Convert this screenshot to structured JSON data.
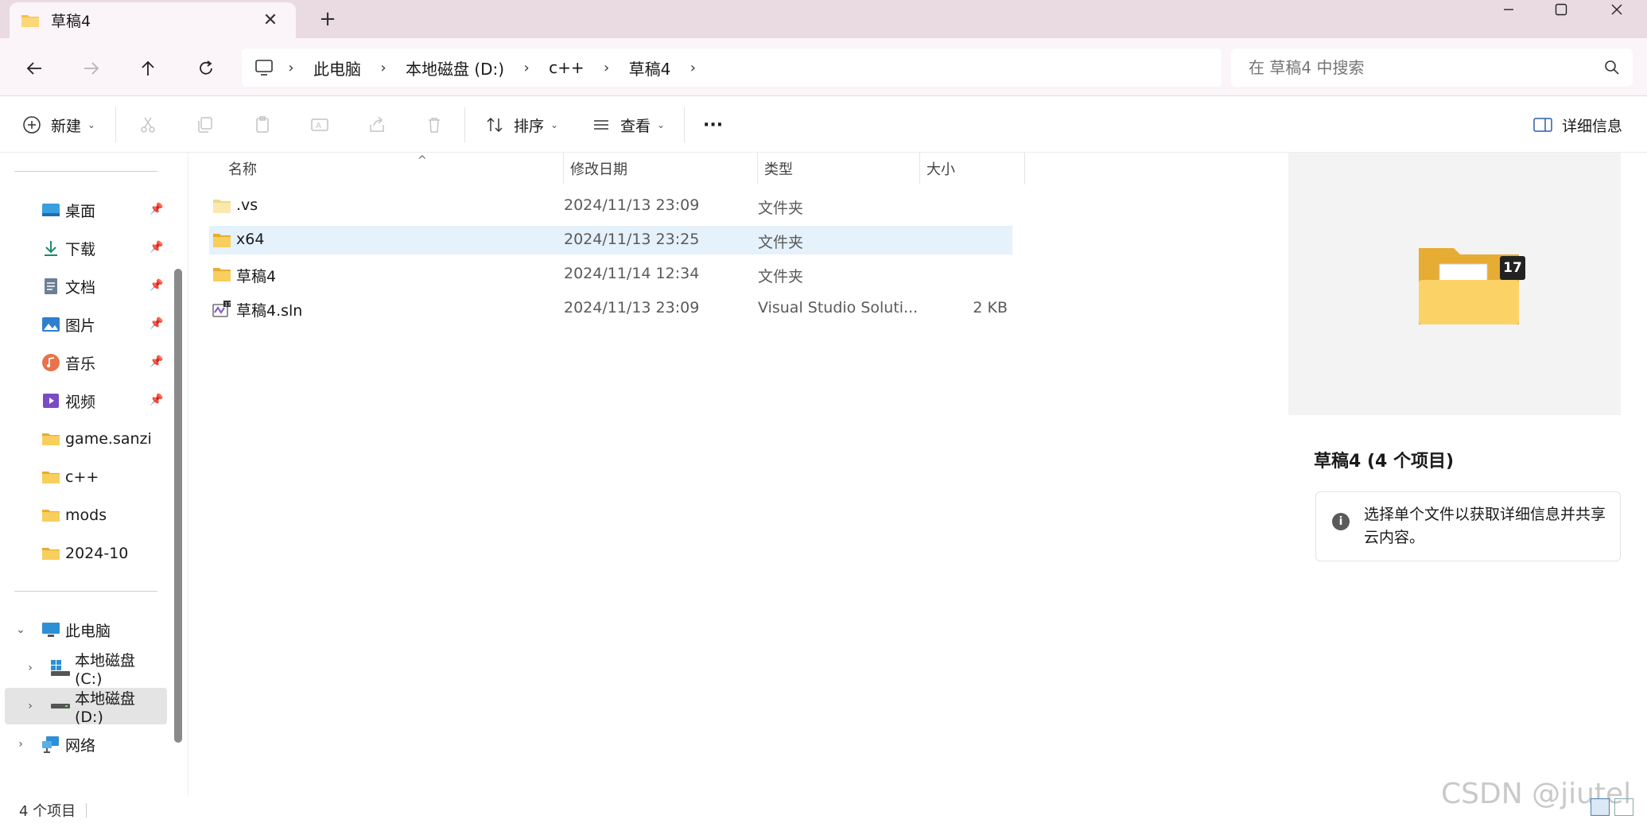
{
  "window": {
    "tab_title": "草稿4",
    "new_tab": "+",
    "close_tab": "✕"
  },
  "nav": {
    "breadcrumb": [
      "此电脑",
      "本地磁盘 (D:)",
      "c++",
      "草稿4"
    ],
    "search_placeholder": "在 草稿4 中搜索"
  },
  "toolbar": {
    "new_label": "新建",
    "sort_label": "排序",
    "view_label": "查看",
    "more_label": "···",
    "details_label": "详细信息"
  },
  "sidebar": {
    "quick_access": [
      {
        "label": "桌面",
        "pinned": true,
        "icon": "desktop-icon"
      },
      {
        "label": "下载",
        "pinned": true,
        "icon": "download-icon"
      },
      {
        "label": "文档",
        "pinned": true,
        "icon": "document-icon"
      },
      {
        "label": "图片",
        "pinned": true,
        "icon": "pictures-icon"
      },
      {
        "label": "音乐",
        "pinned": true,
        "icon": "music-icon"
      },
      {
        "label": "视频",
        "pinned": true,
        "icon": "videos-icon"
      },
      {
        "label": "game.sanzi",
        "pinned": false,
        "icon": "folder-icon"
      },
      {
        "label": "c++",
        "pinned": false,
        "icon": "folder-icon"
      },
      {
        "label": "mods",
        "pinned": false,
        "icon": "folder-icon"
      },
      {
        "label": "2024-10",
        "pinned": false,
        "icon": "folder-icon"
      }
    ],
    "this_pc": "此电脑",
    "drives": [
      {
        "label": "本地磁盘 (C:)",
        "selected": false
      },
      {
        "label": "本地磁盘 (D:)",
        "selected": true
      }
    ],
    "network": "网络"
  },
  "columns": {
    "name": "名称",
    "modified": "修改日期",
    "type": "类型",
    "size": "大小"
  },
  "files": [
    {
      "name": ".vs",
      "modified": "2024/11/13 23:09",
      "type": "文件夹",
      "size": "",
      "icon": "folder-icon",
      "selected": false
    },
    {
      "name": "x64",
      "modified": "2024/11/13 23:25",
      "type": "文件夹",
      "size": "",
      "icon": "folder-icon",
      "selected": true
    },
    {
      "name": "草稿4",
      "modified": "2024/11/14 12:34",
      "type": "文件夹",
      "size": "",
      "icon": "folder-icon",
      "selected": false
    },
    {
      "name": "草稿4.sln",
      "modified": "2024/11/13 23:09",
      "type": "Visual Studio Soluti...",
      "size": "2 KB",
      "icon": "vs-solution-icon",
      "selected": false
    }
  ],
  "details": {
    "badge": "17",
    "title": "草稿4 (4 个项目)",
    "info": "选择单个文件以获取详细信息并共享云内容。"
  },
  "status": {
    "count": "4 个项目"
  },
  "watermark": "CSDN @jiutel",
  "colors": {
    "titlebar": "#eadbe3",
    "navbar": "#fbf4f8",
    "folder": "#f5c04a",
    "selection": "#e5f1fb"
  }
}
